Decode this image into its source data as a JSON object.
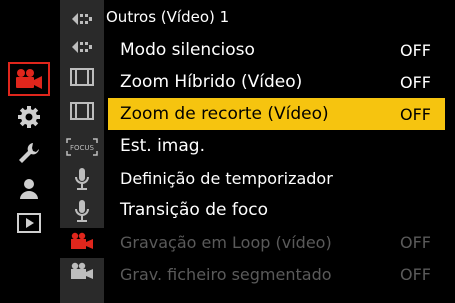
{
  "header": {
    "title": "Outros (Vídeo) 1"
  },
  "main_tabs": [
    {
      "name": "video-tab",
      "icon": "video-camera-icon",
      "active": true
    },
    {
      "name": "setup-tab",
      "icon": "gear-icon",
      "active": false
    },
    {
      "name": "custom-tab",
      "icon": "wrench-icon",
      "active": false
    },
    {
      "name": "my-menu-tab",
      "icon": "person-icon",
      "active": false
    },
    {
      "name": "playback-tab",
      "icon": "playback-icon",
      "active": false
    }
  ],
  "sub_tabs": [
    {
      "icon": "image-quality-icon"
    },
    {
      "icon": "image-quality-icon"
    },
    {
      "icon": "film-frame-icon"
    },
    {
      "icon": "film-frame-icon"
    },
    {
      "icon": "focus-icon",
      "label": "FOCUS"
    },
    {
      "icon": "microphone-icon"
    },
    {
      "icon": "microphone-icon"
    },
    {
      "icon": "red-video-camera-icon",
      "active": true
    },
    {
      "icon": "video-camera-icon"
    }
  ],
  "menu_items": [
    {
      "label": "Modo silencioso",
      "value": "OFF",
      "state": "normal"
    },
    {
      "label": "Zoom Híbrido (Vídeo)",
      "value": "OFF",
      "state": "normal"
    },
    {
      "label": "Zoom de recorte (Vídeo)",
      "value": "OFF",
      "state": "selected"
    },
    {
      "label": "Est. imag.",
      "value": "",
      "state": "normal"
    },
    {
      "label": "Definição de temporizador",
      "value": "",
      "state": "normal"
    },
    {
      "label": "Transição de foco",
      "value": "",
      "state": "normal"
    },
    {
      "label": "Gravação em Loop (vídeo)",
      "value": "OFF",
      "state": "disabled"
    },
    {
      "label": "Grav. ficheiro segmentado",
      "value": "OFF",
      "state": "disabled"
    }
  ],
  "colors": {
    "accent_red": "#e0261c",
    "highlight_yellow": "#f6c40f",
    "disabled_gray": "#5a5a5a"
  }
}
